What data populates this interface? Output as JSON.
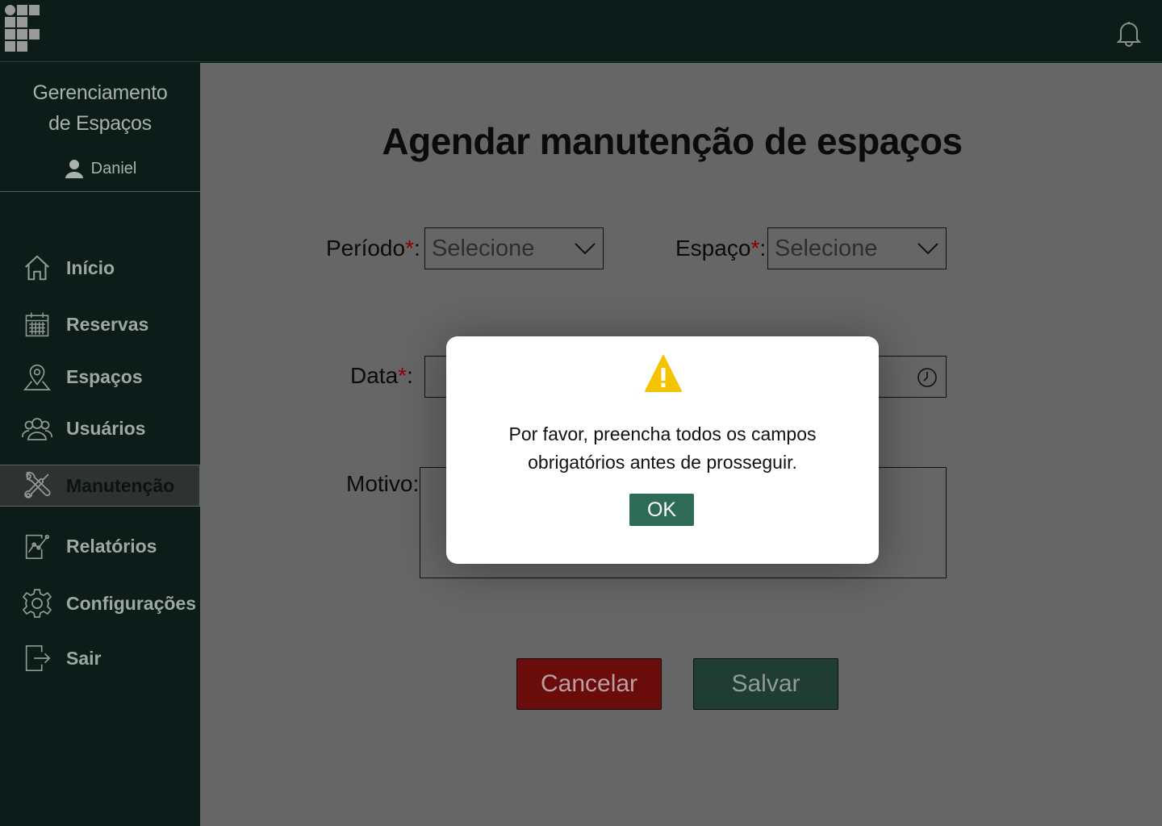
{
  "app": {
    "title_line1": "Gerenciamento",
    "title_line2": "de Espaços",
    "user_name": "Daniel"
  },
  "colors": {
    "sidebar_bg": "#0b1c19",
    "content_bg": "#666666",
    "required_marker": "#8b0000",
    "cancel_bg": "#6b0c0c",
    "save_bg": "#1f3d33",
    "ok_bg": "#2e6b56",
    "warning": "#f5c400"
  },
  "sidebar": {
    "items": [
      {
        "label": "Início",
        "icon": "home-icon"
      },
      {
        "label": "Reservas",
        "icon": "calendar-icon"
      },
      {
        "label": "Espaços",
        "icon": "map-pin-icon"
      },
      {
        "label": "Usuários",
        "icon": "users-icon"
      },
      {
        "label": "Manutenção",
        "icon": "tools-icon",
        "active": true
      },
      {
        "label": "Relatórios",
        "icon": "report-chart-icon"
      },
      {
        "label": "Configurações",
        "icon": "gear-icon"
      },
      {
        "label": "Sair",
        "icon": "logout-icon"
      }
    ]
  },
  "page": {
    "title": "Agendar manutenção de espaços"
  },
  "form": {
    "periodo_label": "Período",
    "espaco_label": "Espaço",
    "data_label": "Data",
    "motivo_label": "Motivo:",
    "required_mark": "*",
    "colon": ":",
    "periodo_value": "Selecione",
    "espaco_value": "Selecione",
    "cancel_label": "Cancelar",
    "save_label": "Salvar"
  },
  "modal": {
    "message_line1": "Por favor, preencha todos os campos",
    "message_line2": "obrigatórios antes de prosseguir.",
    "ok_label": "OK"
  }
}
